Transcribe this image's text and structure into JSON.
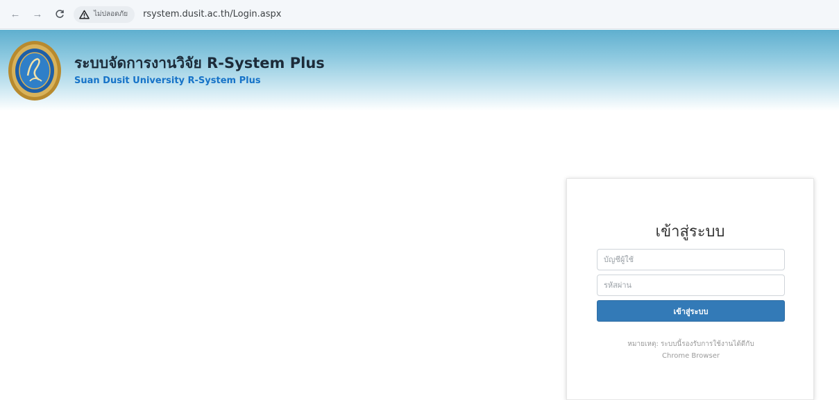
{
  "browser": {
    "back_icon": "←",
    "forward_icon": "→",
    "reload_icon": "C",
    "security_label": "ไม่ปลอดภัย",
    "url": "rsystem.dusit.ac.th/Login.aspx"
  },
  "header": {
    "title": "ระบบจัดการงานวิจัย R-System Plus",
    "subtitle": "Suan Dusit University R-System Plus"
  },
  "login": {
    "title": "เข้าสู่ระบบ",
    "username_placeholder": "บัญชีผู้ใช้",
    "password_placeholder": "รหัสผ่าน",
    "submit_label": "เข้าสู่ระบบ",
    "note_line1": "หมายเหตุ: ระบบนี้รองรับการใช้งานได้ดีกับ",
    "note_line2": "Chrome Browser"
  },
  "colors": {
    "header_gradient_top": "#5fafcf",
    "title": "#1c2b39",
    "subtitle": "#1673c8",
    "button": "#337ab7"
  }
}
